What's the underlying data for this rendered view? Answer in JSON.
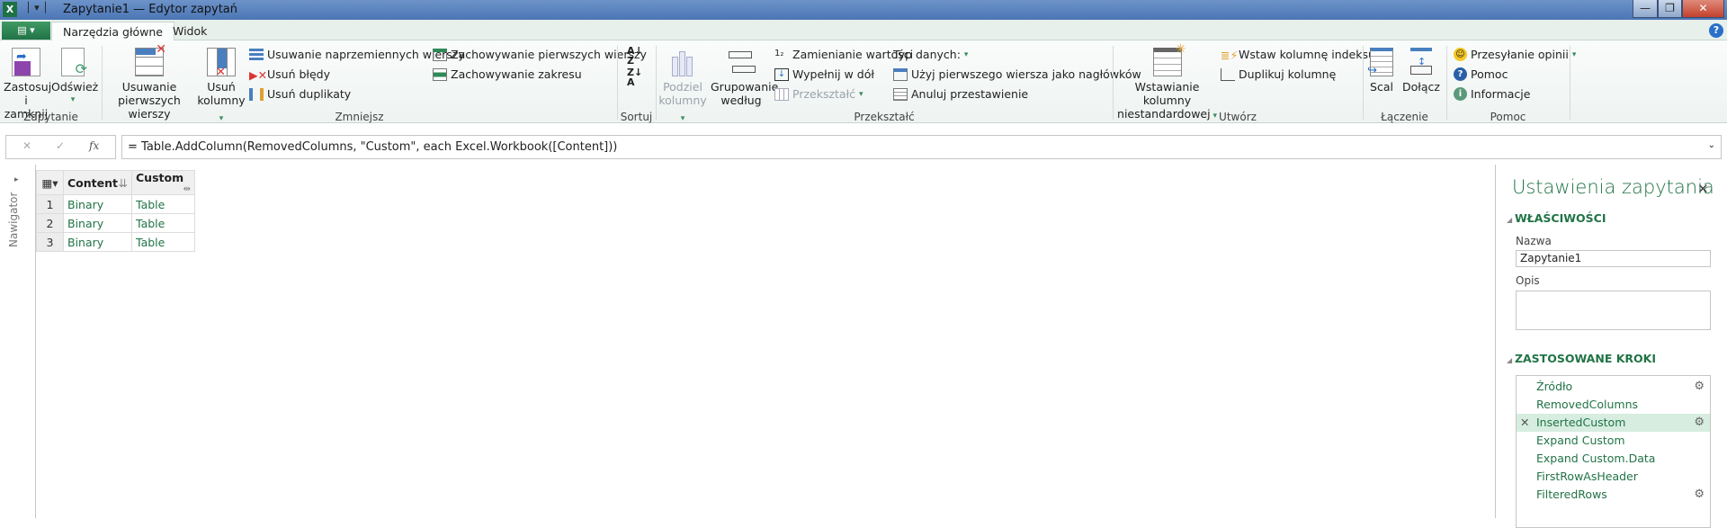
{
  "window": {
    "title": "Zapytanie1 — Edytor zapytań",
    "app_icon": "X",
    "minimize": "—",
    "restore": "❐",
    "close": "✕"
  },
  "tabs": [
    {
      "label": "Narzędzia główne",
      "active": true
    },
    {
      "label": "Widok",
      "active": false
    }
  ],
  "ribbon": {
    "groups": {
      "zapytanie": "Zapytanie",
      "zmniejsz": "Zmniejsz",
      "sortuj": "Sortuj",
      "przeksztalc": "Przekształć",
      "utworz": "Utwórz",
      "laczenie": "Łączenie",
      "pomoc": "Pomoc"
    },
    "apply_close": "Zastosuj i zamknij",
    "refresh": "Odśwież",
    "remove_top_rows": "Usuwanie pierwszych wierszy",
    "remove_columns": "Usuń kolumny",
    "remove_alternate_rows": "Usuwanie naprzemiennych wierszy",
    "remove_errors": "Usuń błędy",
    "remove_duplicates": "Usuń duplikaty",
    "keep_top_rows": "Zachowywanie pierwszych wierszy",
    "keep_range": "Zachowywanie zakresu",
    "split_column": "Podziel kolumny",
    "group_by": "Grupowanie według",
    "replace_values": "Zamienianie wartości",
    "fill_down": "Wypełnij w dół",
    "transform": "Przekształć",
    "data_type": "Typ danych:",
    "use_first_row": "Użyj pierwszego wiersza jako nagłówków",
    "unpivot": "Anuluj przestawienie",
    "insert_custom_column": "Wstawianie kolumny niestandardowej",
    "insert_index_column": "Wstaw kolumnę indeksu",
    "duplicate_column": "Duplikuj kolumnę",
    "merge": "Scal",
    "append": "Dołącz",
    "feedback": "Przesyłanie opinii",
    "help": "Pomoc",
    "info": "Informacje"
  },
  "formula": {
    "text": "= Table.AddColumn(RemovedColumns, \"Custom\", each Excel.Workbook([Content]))",
    "fx": "fx"
  },
  "navigator": {
    "label": "Nawigator"
  },
  "grid": {
    "columns": [
      "Content",
      "Custom"
    ],
    "rows": [
      {
        "n": "1",
        "content": "Binary",
        "custom": "Table"
      },
      {
        "n": "2",
        "content": "Binary",
        "custom": "Table"
      },
      {
        "n": "3",
        "content": "Binary",
        "custom": "Table"
      }
    ]
  },
  "panel": {
    "title": "Ustawienia zapytania",
    "properties": "WŁAŚCIWOŚCI",
    "name_label": "Nazwa",
    "name_value": "Zapytanie1",
    "desc_label": "Opis",
    "desc_value": "",
    "steps_label": "ZASTOSOWANE KROKI",
    "steps": [
      {
        "label": "Źródło",
        "gear": true
      },
      {
        "label": "RemovedColumns",
        "gear": false
      },
      {
        "label": "InsertedCustom",
        "gear": true,
        "selected": true
      },
      {
        "label": "Expand Custom",
        "gear": false
      },
      {
        "label": "Expand Custom.Data",
        "gear": false
      },
      {
        "label": "FirstRowAsHeader",
        "gear": false
      },
      {
        "label": "FilteredRows",
        "gear": true
      }
    ]
  },
  "colors": {
    "accent": "#217346",
    "title_bar": "#4b76b5",
    "selected_step": "#d6ede0"
  }
}
